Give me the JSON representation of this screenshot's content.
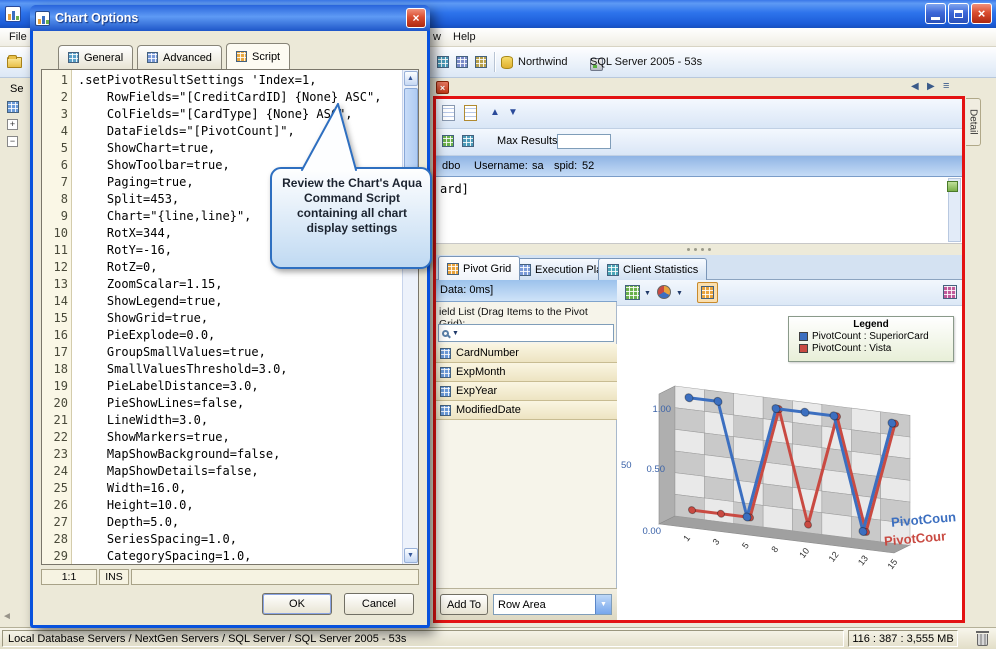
{
  "dialog": {
    "title": "Chart Options",
    "tabs": [
      {
        "label": "General"
      },
      {
        "label": "Advanced"
      },
      {
        "label": "Script"
      }
    ],
    "code_lines": [
      ".setPivotResultSettings 'Index=1,",
      "    RowFields=\"[CreditCardID] {None} ASC\",",
      "    ColFields=\"[CardType] {None} ASC\",",
      "    DataFields=\"[PivotCount]\",",
      "    ShowChart=true,",
      "    ShowToolbar=true,",
      "    Paging=true,",
      "    Split=453,",
      "    Chart=\"{line,line}\",",
      "    RotX=344,",
      "    RotY=-16,",
      "    RotZ=0,",
      "    ZoomScalar=1.15,",
      "    ShowLegend=true,",
      "    ShowGrid=true,",
      "    PieExplode=0.0,",
      "    GroupSmallValues=true,",
      "    SmallValuesThreshold=3.0,",
      "    PieLabelDistance=3.0,",
      "    PieShowLines=false,",
      "    LineWidth=3.0,",
      "    ShowMarkers=true,",
      "    MapShowBackground=false,",
      "    MapShowDetails=false,",
      "    Width=16.0,",
      "    Height=10.0,",
      "    Depth=5.0,",
      "    SeriesSpacing=1.0,",
      "    CategorySpacing=1.0,"
    ],
    "status": {
      "caret": "1:1",
      "mode": "INS"
    },
    "buttons": {
      "ok": "OK",
      "cancel": "Cancel"
    },
    "callout": "Review the Chart's Aqua Command Script containing all chart display settings"
  },
  "main": {
    "menu": {
      "file": "File",
      "window_fragment": "w",
      "help": "Help"
    },
    "toolbar": {
      "connection": "Northwind",
      "server": "SQL Server 2005 - 53s"
    },
    "servers_panel_fragment": "Se",
    "detail_tab": "Detail",
    "query": {
      "max_results_label": "Max Results:",
      "max_results_value": "",
      "info": {
        "schema": "dbo",
        "user_label": "Username:",
        "user": "sa",
        "spid_label": "spid:",
        "spid": "52"
      },
      "sql_fragment": "ard]",
      "result_tabs": [
        {
          "label": "Pivot Grid"
        },
        {
          "label": "Execution Plan"
        },
        {
          "label": "Client Statistics"
        }
      ],
      "data_bar": "Data: 0ms]",
      "field_list_label": "ield List (Drag Items to the Pivot Grid):",
      "fields": [
        {
          "name": "CardNumber"
        },
        {
          "name": "ExpMonth"
        },
        {
          "name": "ExpYear"
        },
        {
          "name": "ModifiedDate"
        }
      ],
      "add_to_label": "Add To",
      "area_selector": "Row Area"
    },
    "chart": {
      "legend_title": "Legend",
      "legend": [
        {
          "label": "PivotCount : SuperiorCard",
          "color": "#3C6FC0"
        },
        {
          "label": "PivotCount : Vista",
          "color": "#C94A42"
        }
      ],
      "y_labels": [
        "1.00",
        "0.50",
        "0.00"
      ],
      "y_label_partial": "50",
      "series_labels": [
        {
          "text": "PivotCoun",
          "color": "#3C6FC0"
        },
        {
          "text": "PivotCour",
          "color": "#C94A42"
        }
      ],
      "chart_data": {
        "type": "line",
        "categories": [
          "1",
          "3",
          "5",
          "8",
          "10",
          "12",
          "13",
          "15"
        ],
        "series": [
          {
            "name": "PivotCount : SuperiorCard",
            "values": [
              1,
              1,
              0,
              1,
              1,
              1,
              0,
              1
            ]
          },
          {
            "name": "PivotCount : Vista",
            "values": [
              0,
              0,
              0,
              1,
              0,
              1,
              0,
              1
            ]
          }
        ],
        "ylim": [
          0,
          1
        ]
      }
    },
    "statusbar": {
      "path": "Local Database Servers / NextGen Servers / SQL Server / SQL Server 2005 - 53s",
      "stats": "116 : 387 : 3,555 MB"
    }
  }
}
